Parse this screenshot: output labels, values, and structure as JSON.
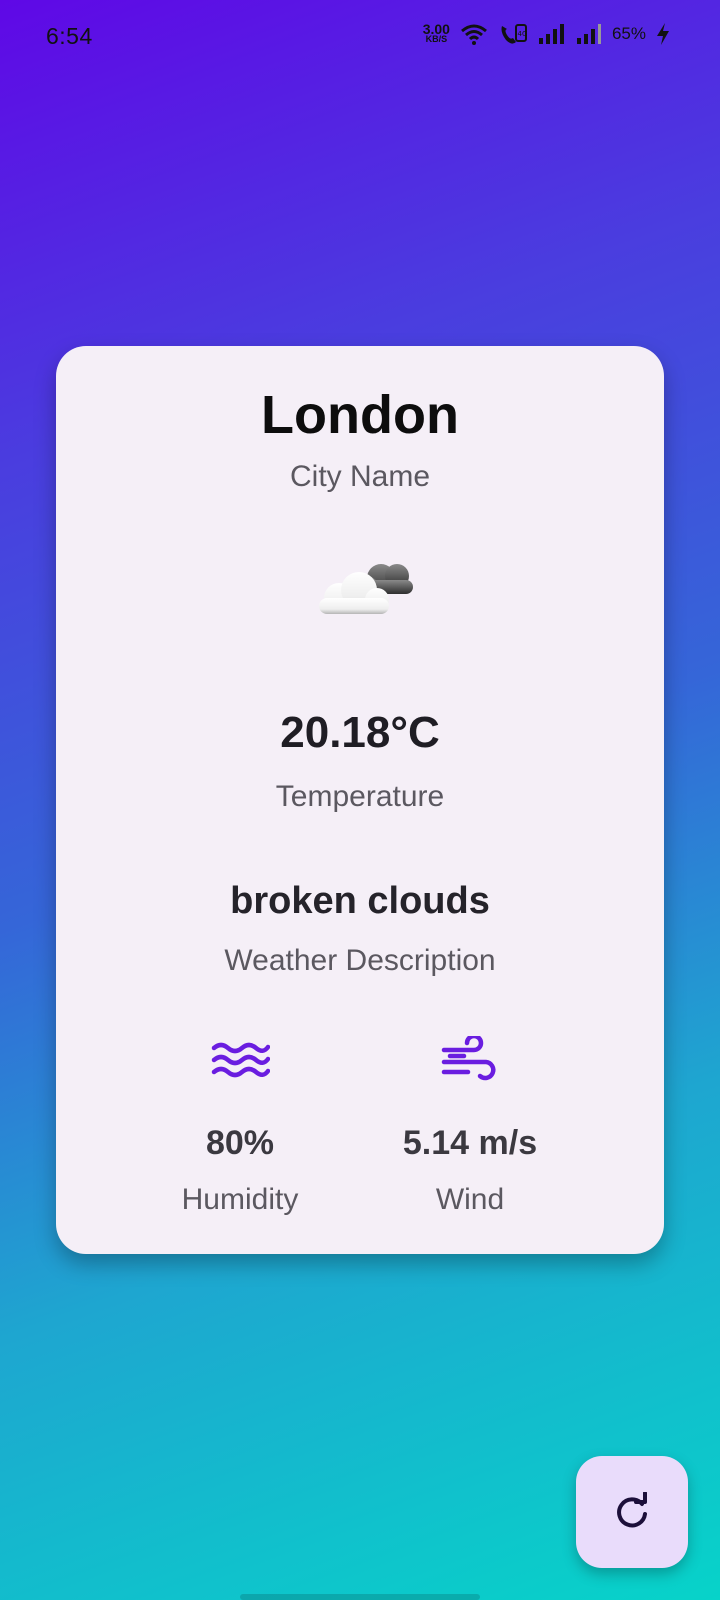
{
  "status_bar": {
    "time": "6:54",
    "net_speed_value": "3.00",
    "net_speed_unit": "KB/S",
    "battery": "65%",
    "icons": [
      "wifi-icon",
      "volte-icon",
      "signal-icon",
      "signal-icon",
      "charging-icon"
    ]
  },
  "weather": {
    "city": "London",
    "city_label": "City Name",
    "icon": "broken-clouds-icon",
    "temperature": "20.18°C",
    "temperature_label": "Temperature",
    "description": "broken clouds",
    "description_label": "Weather Description",
    "humidity": {
      "icon": "waves-icon",
      "value": "80%",
      "label": "Humidity"
    },
    "wind": {
      "icon": "wind-icon",
      "value": "5.14 m/s",
      "label": "Wind"
    }
  },
  "actions": {
    "refresh_icon": "refresh-icon"
  },
  "colors": {
    "accent": "#6a1de0",
    "card_bg": "#f5eff7",
    "fab_bg": "#e9dcfb",
    "gradient_top": "#5f08e6",
    "gradient_bottom": "#07d3c9"
  }
}
